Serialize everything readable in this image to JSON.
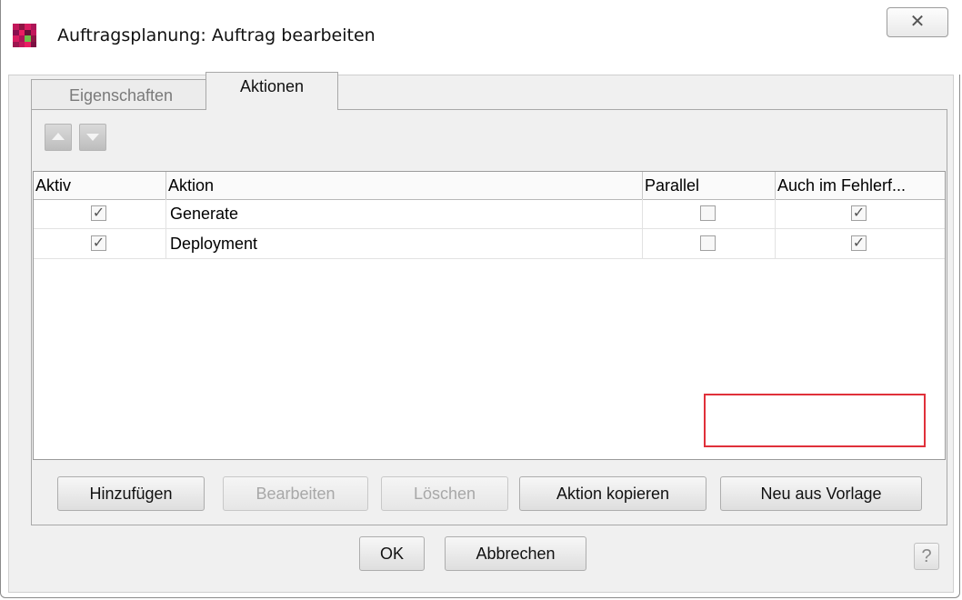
{
  "window": {
    "title": "Auftragsplanung: Auftrag bearbeiten",
    "close_glyph": "✕",
    "icon": "app-grid-icon"
  },
  "tabs": [
    {
      "label": "Eigenschaften",
      "active": false
    },
    {
      "label": "Aktionen",
      "active": true
    }
  ],
  "toolbar": {
    "up_icon": "arrow-up-icon",
    "down_icon": "arrow-down-icon"
  },
  "table": {
    "columns": [
      "Aktiv",
      "Aktion",
      "Parallel",
      "Auch im Fehlerf..."
    ],
    "rows": [
      {
        "aktiv": true,
        "aktion": "Generate",
        "parallel": false,
        "fehler": true
      },
      {
        "aktiv": true,
        "aktion": "Deployment",
        "parallel": false,
        "fehler": true
      }
    ]
  },
  "actions": {
    "add": "Hinzufügen",
    "edit": "Bearbeiten",
    "delete": "Löschen",
    "copy": "Aktion kopieren",
    "from_template": "Neu aus Vorlage"
  },
  "footer": {
    "ok": "OK",
    "cancel": "Abbrechen",
    "help": "?"
  },
  "colors": {
    "highlight": "#e0303a",
    "icon_magenta": "#b0174f"
  }
}
